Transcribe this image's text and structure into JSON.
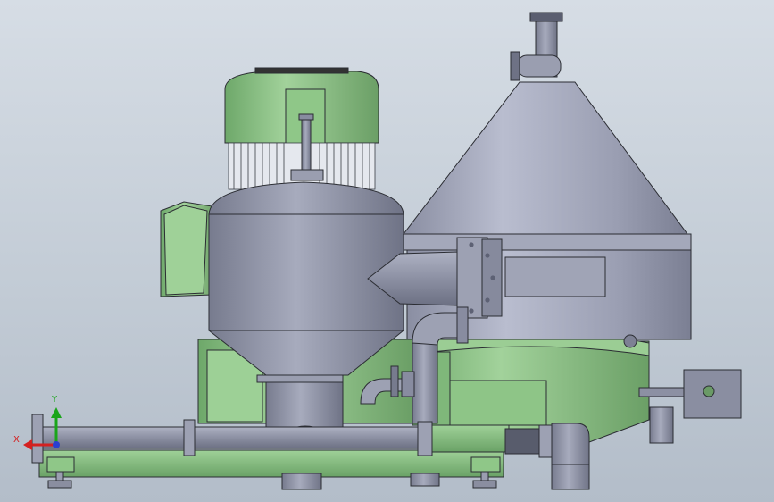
{
  "view": {
    "colors": {
      "background_top": "#d6dde5",
      "background_bottom": "#b3bdc9",
      "steel": "#8f93a6",
      "steel_light": "#b6bacb",
      "steel_dark": "#6e7285",
      "green": "#7fb77a",
      "green_light": "#a9d7a1",
      "green_dark": "#5b8f57",
      "edge": "#2b2d33"
    }
  },
  "triad": {
    "x_label": "X",
    "y_label": "Y",
    "x_color": "#d42020",
    "y_color": "#1aa51a",
    "z_color": "#2a3fd0"
  }
}
